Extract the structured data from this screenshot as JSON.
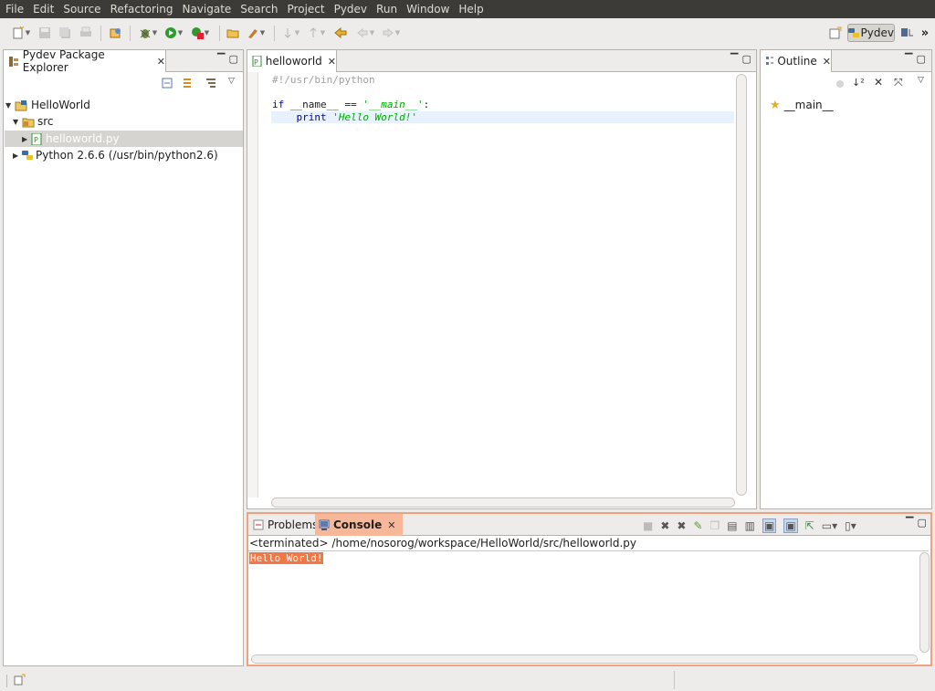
{
  "menu": [
    "File",
    "Edit",
    "Source",
    "Refactoring",
    "Navigate",
    "Search",
    "Project",
    "Pydev",
    "Run",
    "Window",
    "Help"
  ],
  "perspective": {
    "label": "Pydev",
    "more": "»"
  },
  "explorer": {
    "title": "Pydev Package Explorer",
    "tree": {
      "project": "HelloWorld",
      "src": "src",
      "file": "helloworld.py",
      "interpreter": "Python 2.6.6  (/usr/bin/python2.6)"
    }
  },
  "editor": {
    "tab": "helloworld",
    "lines": {
      "l1": "#!/usr/bin/python",
      "l2_kw": "if",
      "l2_name": "__name__",
      "l2_op": "==",
      "l2_str": "'__main__'",
      "l2_colon": ":",
      "l3_kw": "print",
      "l3_str": "'Hello World!'"
    }
  },
  "outline": {
    "title": "Outline",
    "items": [
      "__main__"
    ]
  },
  "bottom": {
    "tabs": {
      "problems": "Problems",
      "console": "Console"
    },
    "status": "<terminated> /home/nosorog/workspace/HelloWorld/src/helloworld.py",
    "output": "Hello World!"
  },
  "colors": {
    "menubar_bg": "#3c3b37",
    "selection": "#f07746",
    "keyword": "#0000c0",
    "string": "#00aa00",
    "comment": "#a0a0a0"
  },
  "icons": [
    "new-icon",
    "save-icon",
    "save-all-icon",
    "print-icon",
    "open-type-icon",
    "debug-icon",
    "run-icon",
    "coverage-icon",
    "open-folder-icon",
    "brush-icon",
    "next-annotation-icon",
    "prev-annotation-icon",
    "last-edit-icon",
    "back-icon",
    "forward-icon",
    "open-perspective-icon",
    "python-icon"
  ]
}
